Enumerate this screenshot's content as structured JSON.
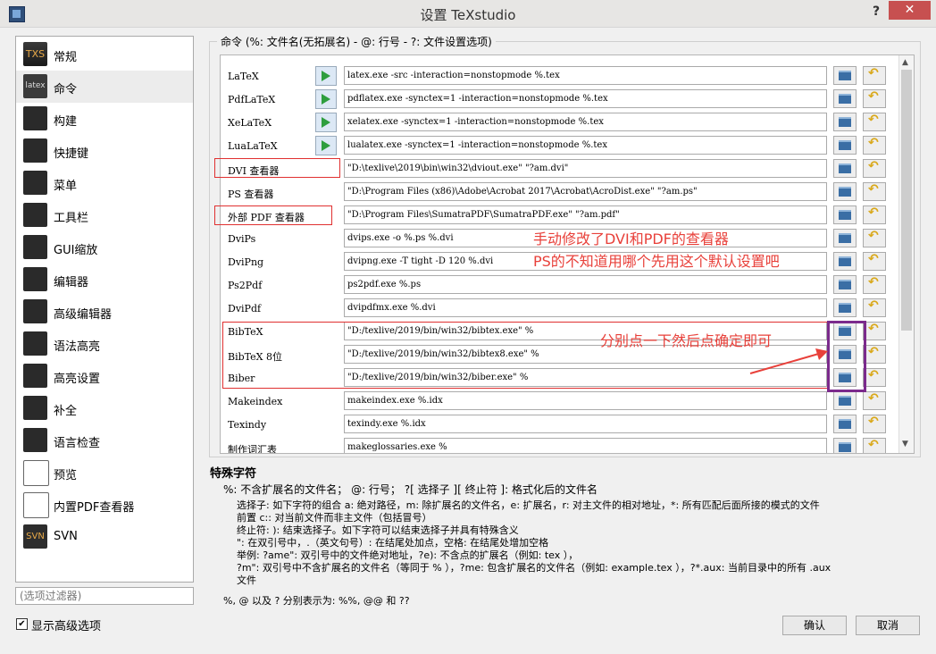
{
  "window": {
    "title": "设置 TeXstudio",
    "help_label": "?",
    "close_label": "✕"
  },
  "sidebar": {
    "items": [
      {
        "label": "常规",
        "icon": "txs-icon",
        "icon_text": "TXS"
      },
      {
        "label": "命令",
        "icon": "latex-icon",
        "icon_text": "latex"
      },
      {
        "label": "构建",
        "icon": "build-icon",
        "icon_text": ""
      },
      {
        "label": "快捷键",
        "icon": "keyboard-icon",
        "icon_text": ""
      },
      {
        "label": "菜单",
        "icon": "menu-icon",
        "icon_text": ""
      },
      {
        "label": "工具栏",
        "icon": "toolbar-icon",
        "icon_text": ""
      },
      {
        "label": "GUI缩放",
        "icon": "gui-scale-icon",
        "icon_text": ""
      },
      {
        "label": "编辑器",
        "icon": "editor-icon",
        "icon_text": ""
      },
      {
        "label": "高级编辑器",
        "icon": "advanced-editor-icon",
        "icon_text": ""
      },
      {
        "label": "语法高亮",
        "icon": "syntax-highlight-icon",
        "icon_text": ""
      },
      {
        "label": "高亮设置",
        "icon": "highlight-settings-icon",
        "icon_text": ""
      },
      {
        "label": "补全",
        "icon": "completion-icon",
        "icon_text": ""
      },
      {
        "label": "语言检查",
        "icon": "language-check-icon",
        "icon_text": ""
      },
      {
        "label": "预览",
        "icon": "preview-icon",
        "icon_text": ""
      },
      {
        "label": "内置PDF查看器",
        "icon": "pdf-viewer-icon",
        "icon_text": ""
      },
      {
        "label": "SVN",
        "icon": "svn-icon",
        "icon_text": "SVN"
      }
    ],
    "selected_index": 1,
    "filter_placeholder": "(选项过滤器)",
    "show_advanced_label": "显示高级选项",
    "show_advanced_checked": "✔"
  },
  "commands": {
    "group_title": "命令 (%: 文件名(无拓展名) - @: 行号 - ?: 文件设置选项)",
    "rows": [
      {
        "label": "LaTeX",
        "value": "latex.exe -src -interaction=nonstopmode %.tex",
        "has_run": true
      },
      {
        "label": "PdfLaTeX",
        "value": "pdflatex.exe -synctex=1 -interaction=nonstopmode %.tex",
        "has_run": true
      },
      {
        "label": "XeLaTeX",
        "value": "xelatex.exe -synctex=1 -interaction=nonstopmode %.tex",
        "has_run": true
      },
      {
        "label": "LuaLaTeX",
        "value": "lualatex.exe -synctex=1 -interaction=nonstopmode %.tex",
        "has_run": true
      },
      {
        "label": "DVI 查看器",
        "value": "\"D:\\texlive\\2019\\bin\\win32\\dviout.exe\" \"?am.dvi\"",
        "has_run": false
      },
      {
        "label": "PS 查看器",
        "value": "\"D:\\Program Files (x86)\\Adobe\\Acrobat 2017\\Acrobat\\AcroDist.exe\" \"?am.ps\"",
        "has_run": false
      },
      {
        "label": "外部 PDF 查看器",
        "value": "\"D:\\Program Files\\SumatraPDF\\SumatraPDF.exe\" \"?am.pdf\"",
        "has_run": false
      },
      {
        "label": "DviPs",
        "value": "dvips.exe -o %.ps %.dvi",
        "has_run": false
      },
      {
        "label": "DviPng",
        "value": "dvipng.exe -T tight -D 120 %.dvi",
        "has_run": false
      },
      {
        "label": "Ps2Pdf",
        "value": "ps2pdf.exe %.ps",
        "has_run": false
      },
      {
        "label": "DviPdf",
        "value": "dvipdfmx.exe %.dvi",
        "has_run": false
      },
      {
        "label": "BibTeX",
        "value": "\"D:/texlive/2019/bin/win32/bibtex.exe\" %",
        "has_run": false
      },
      {
        "label": "BibTeX 8位",
        "value": "\"D:/texlive/2019/bin/win32/bibtex8.exe\" %",
        "has_run": false
      },
      {
        "label": "Biber",
        "value": "\"D:/texlive/2019/bin/win32/biber.exe\" %",
        "has_run": false
      },
      {
        "label": "Makeindex",
        "value": "makeindex.exe %.idx",
        "has_run": false
      },
      {
        "label": "Texindy",
        "value": "texindy.exe %.idx",
        "has_run": false
      },
      {
        "label": "制作词汇表",
        "value": "makeglossaries.exe %",
        "has_run": false
      }
    ]
  },
  "annotations": {
    "viewer_note_line1": "手动修改了DVI和PDF的查看器",
    "viewer_note_line2": "PS的不知道用哪个先用这个默认设置吧",
    "click_note": "分别点一下然后点确定即可",
    "color": "#e8403a",
    "box_color": "#7b2a8c"
  },
  "help": {
    "title": "特殊字符",
    "line1": "%: 不含扩展名的文件名； @: 行号； ?[ 选择子 ][ 终止符 ]: 格式化后的文件名",
    "lines": [
      "选择子: 如下字符的组合 a: 绝对路径，m: 除扩展名的文件名，e: 扩展名，r: 对主文件的相对地址，*: 所有匹配后面所接的模式的文件",
      "前置 c:: 对当前文件而非主文件（包括冒号）",
      "终止符: ): 结束选择子。如下字符可以结束选择子并具有特殊含义",
      "\": 在双引号中，.（英文句号）: 在结尾处加点，空格: 在结尾处增加空格",
      "举例: ?ame\": 双引号中的文件绝对地址，?e): 不含点的扩展名（例如: tex ），",
      "?m\": 双引号中不含扩展名的文件名（等同于 % ），?me: 包含扩展名的文件名（例如: example.tex ），?*.aux: 当前目录中的所有 .aux",
      "文件"
    ],
    "percent_line": "%, @ 以及 ? 分别表示为: %%, @@ 和 ??"
  },
  "buttons": {
    "ok": "确认",
    "cancel": "取消"
  }
}
